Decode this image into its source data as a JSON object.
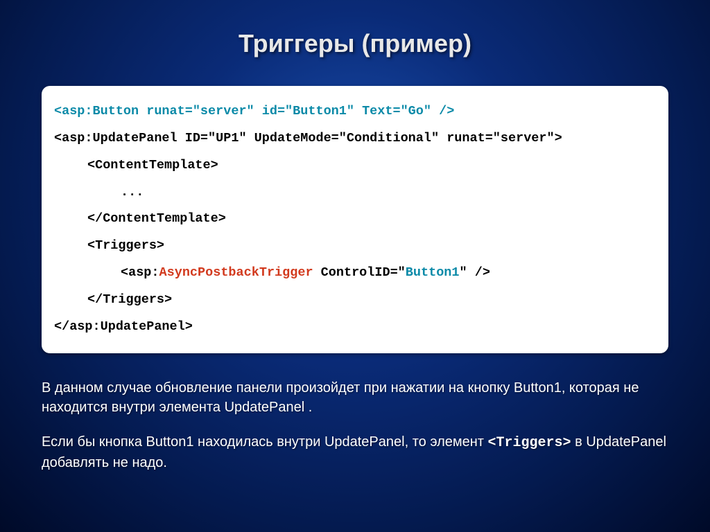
{
  "title": "Триггеры (пример)",
  "code": {
    "l1": "<asp:Button runat=\"server\" id=\"Button1\" Text=\"Go\" />",
    "l2": "<asp:UpdatePanel ID=\"UP1\" UpdateMode=\"Conditional\" runat=\"server\">",
    "l3": "<ContentTemplate>",
    "l4": "...",
    "l5": "</ContentTemplate>",
    "l6": "<Triggers>",
    "l7a": "<asp:",
    "l7b": "AsyncPostbackTrigger",
    "l7c": " ControlID=\"",
    "l7d": "Button1",
    "l7e": "\" />",
    "l8": "</Triggers>",
    "l9": "</asp:UpdatePanel>"
  },
  "para1": "В данном случае обновление панели произойдет при нажатии на кнопку Button1, которая не  находится внутри элемента UpdatePanel .",
  "para2_a": "Если бы кнопка Button1 находилась внутри UpdatePanel, то элемент ",
  "para2_tag": "<Triggers>",
  "para2_b": "  в UpdatePanel добавлять не надо."
}
